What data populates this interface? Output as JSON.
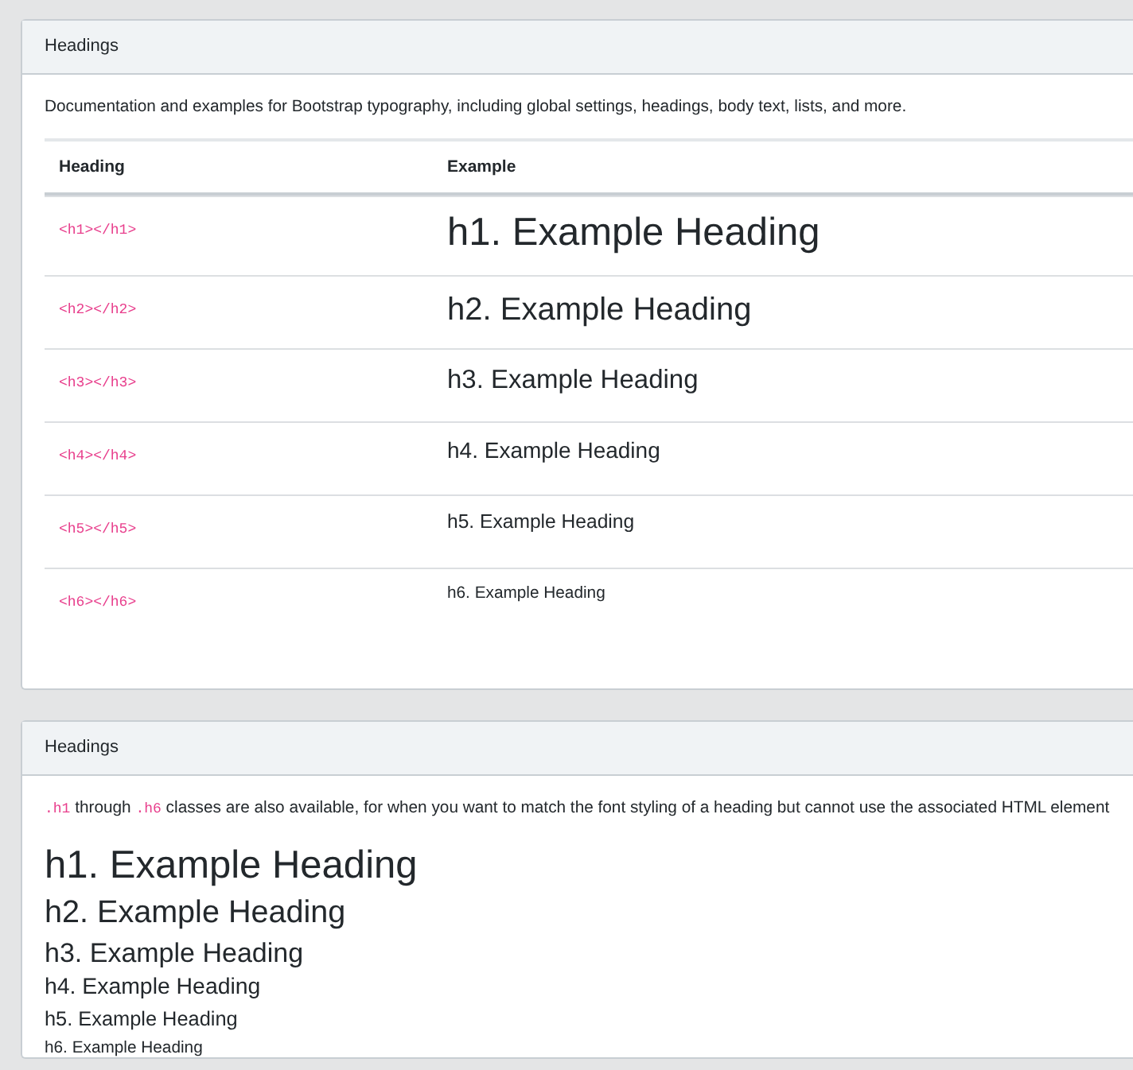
{
  "cards": [
    {
      "header": "Headings",
      "description": "Documentation and examples for Bootstrap typography, including global settings, headings, body text, lists, and more.",
      "table": {
        "columns": [
          "Heading",
          "Example"
        ],
        "rows": [
          {
            "tag": "<h1></h1>",
            "example": "h1. Example Heading",
            "kind": "h1"
          },
          {
            "tag": "<h2></h2>",
            "example": "h2. Example Heading",
            "kind": "h2"
          },
          {
            "tag": "<h3></h3>",
            "example": "h3. Example Heading",
            "kind": "h3"
          },
          {
            "tag": "<h4></h4>",
            "example": "h4. Example Heading",
            "kind": "h4"
          },
          {
            "tag": "<h5></h5>",
            "example": "h5. Example Heading",
            "kind": "h5"
          },
          {
            "tag": "<h6></h6>",
            "example": "h6. Example Heading",
            "kind": "h6"
          }
        ]
      }
    },
    {
      "header": "Headings",
      "description_parts": [
        {
          "kind": "code",
          "text": ".h1"
        },
        {
          "kind": "text",
          "text": " through "
        },
        {
          "kind": "code",
          "text": ".h6"
        },
        {
          "kind": "text",
          "text": " classes are also available, for when you want to match the font styling of a heading but cannot use the associated HTML element"
        }
      ],
      "examples": [
        {
          "text": "h1. Example Heading",
          "kind": "h1"
        },
        {
          "text": "h2. Example Heading",
          "kind": "h2"
        },
        {
          "text": "h3. Example Heading",
          "kind": "h3"
        },
        {
          "text": "h4. Example Heading",
          "kind": "h4"
        },
        {
          "text": "h5. Example Heading",
          "kind": "h5"
        },
        {
          "text": "h6. Example Heading",
          "kind": "h6"
        }
      ]
    }
  ]
}
